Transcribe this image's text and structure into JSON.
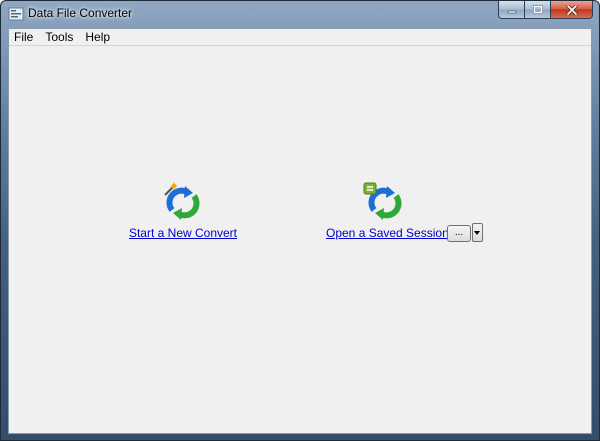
{
  "window": {
    "title": "Data File Converter"
  },
  "menu": [
    "File",
    "Tools",
    "Help"
  ],
  "actions": {
    "new_convert": {
      "label": "Start a New Convert",
      "icon": "convert-wand-icon"
    },
    "open_session": {
      "label": "Open a Saved Session",
      "icon": "convert-session-icon",
      "browse_label": "..."
    }
  },
  "colors": {
    "link": "#0000cc",
    "client_bg": "#f0f0f0",
    "arrow_green": "#2fa838",
    "arrow_blue": "#1d6fd6"
  }
}
